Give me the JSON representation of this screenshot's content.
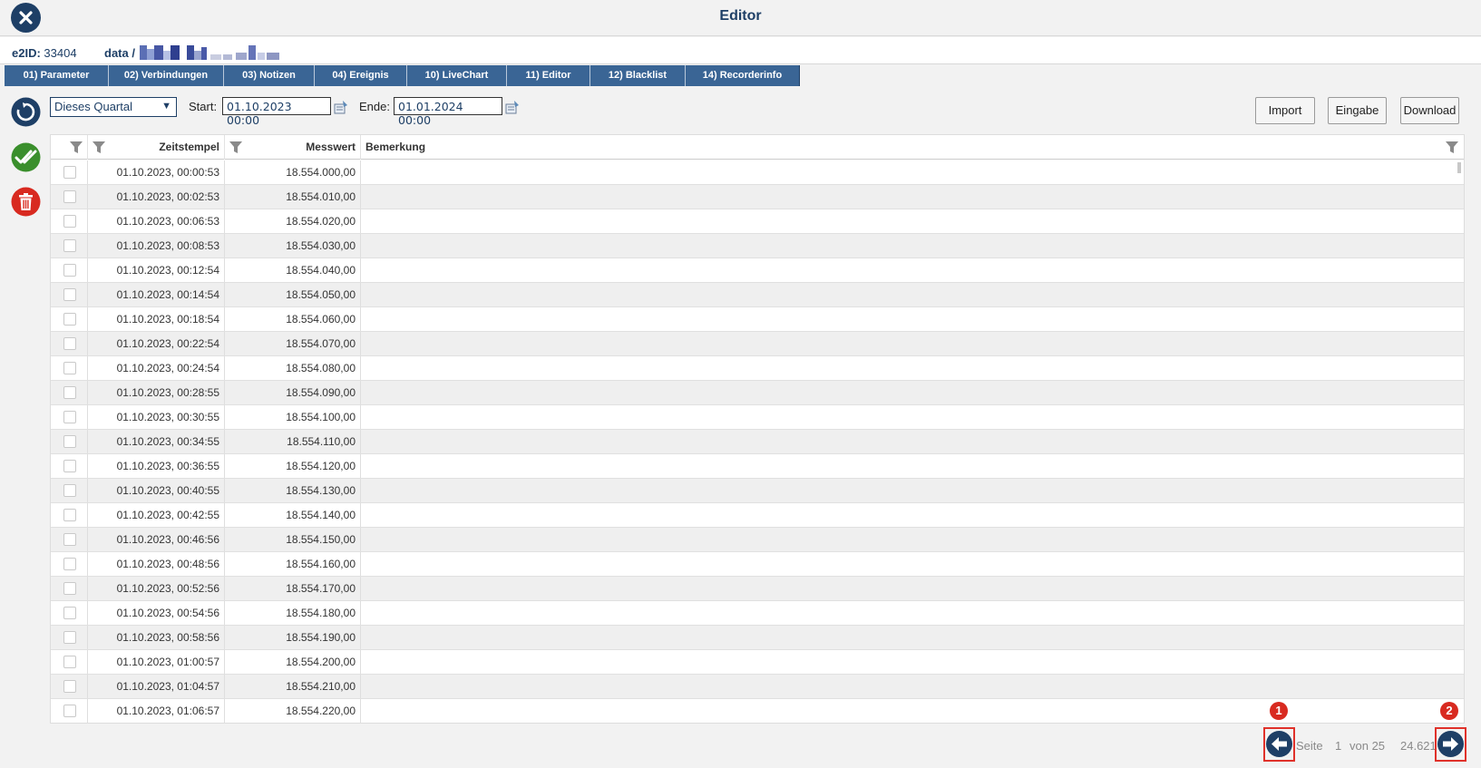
{
  "header": {
    "title": "Editor"
  },
  "info": {
    "e2id_label": "e2ID:",
    "e2id_value": "33404",
    "data_label": "data /"
  },
  "tabs": [
    {
      "label": "01) Parameter"
    },
    {
      "label": "02) Verbindungen"
    },
    {
      "label": "03) Notizen"
    },
    {
      "label": "04) Ereignis"
    },
    {
      "label": "10) LiveChart"
    },
    {
      "label": "11) Editor"
    },
    {
      "label": "12) Blacklist"
    },
    {
      "label": "14) Recorderinfo"
    }
  ],
  "toolbar": {
    "period_value": "Dieses Quartal",
    "start_label": "Start:",
    "start_value": "01.10.2023 00:00",
    "end_label": "Ende:",
    "end_value": "01.01.2024 00:00",
    "import_label": "Import",
    "eingabe_label": "Eingabe",
    "download_label": "Download"
  },
  "grid": {
    "col_time": "Zeitstempel",
    "col_value": "Messwert",
    "col_remark": "Bemerkung",
    "rows": [
      {
        "time": "01.10.2023, 00:00:53",
        "value": "18.554.000,00"
      },
      {
        "time": "01.10.2023, 00:02:53",
        "value": "18.554.010,00"
      },
      {
        "time": "01.10.2023, 00:06:53",
        "value": "18.554.020,00"
      },
      {
        "time": "01.10.2023, 00:08:53",
        "value": "18.554.030,00"
      },
      {
        "time": "01.10.2023, 00:12:54",
        "value": "18.554.040,00"
      },
      {
        "time": "01.10.2023, 00:14:54",
        "value": "18.554.050,00"
      },
      {
        "time": "01.10.2023, 00:18:54",
        "value": "18.554.060,00"
      },
      {
        "time": "01.10.2023, 00:22:54",
        "value": "18.554.070,00"
      },
      {
        "time": "01.10.2023, 00:24:54",
        "value": "18.554.080,00"
      },
      {
        "time": "01.10.2023, 00:28:55",
        "value": "18.554.090,00"
      },
      {
        "time": "01.10.2023, 00:30:55",
        "value": "18.554.100,00"
      },
      {
        "time": "01.10.2023, 00:34:55",
        "value": "18.554.110,00"
      },
      {
        "time": "01.10.2023, 00:36:55",
        "value": "18.554.120,00"
      },
      {
        "time": "01.10.2023, 00:40:55",
        "value": "18.554.130,00"
      },
      {
        "time": "01.10.2023, 00:42:55",
        "value": "18.554.140,00"
      },
      {
        "time": "01.10.2023, 00:46:56",
        "value": "18.554.150,00"
      },
      {
        "time": "01.10.2023, 00:48:56",
        "value": "18.554.160,00"
      },
      {
        "time": "01.10.2023, 00:52:56",
        "value": "18.554.170,00"
      },
      {
        "time": "01.10.2023, 00:54:56",
        "value": "18.554.180,00"
      },
      {
        "time": "01.10.2023, 00:58:56",
        "value": "18.554.190,00"
      },
      {
        "time": "01.10.2023, 01:00:57",
        "value": "18.554.200,00"
      },
      {
        "time": "01.10.2023, 01:04:57",
        "value": "18.554.210,00"
      },
      {
        "time": "01.10.2023, 01:06:57",
        "value": "18.554.220,00"
      }
    ]
  },
  "pager": {
    "badge_prev": "1",
    "badge_next": "2",
    "page_label": "Seite",
    "page_current": "1",
    "page_of": "von 25",
    "total": "24.621"
  },
  "colors": {
    "brand": "#1e3f66",
    "tab": "#3a6595",
    "accent_red": "#d82a20",
    "ok_green": "#3a8f2c"
  }
}
